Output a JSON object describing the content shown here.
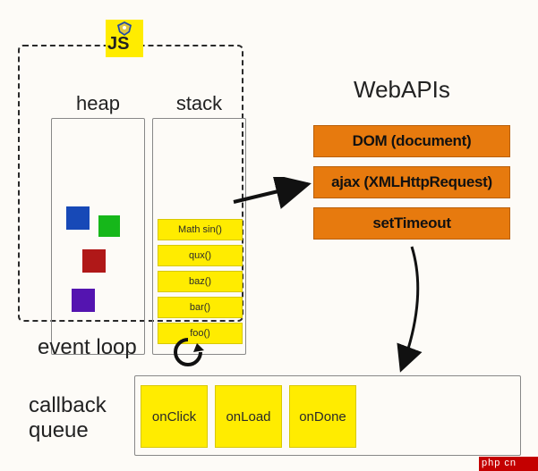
{
  "badge": {
    "label": "JS"
  },
  "heap": {
    "title": "heap"
  },
  "stack": {
    "title": "stack",
    "items": [
      "Math sin()",
      "qux()",
      "baz()",
      "bar()",
      "foo()"
    ]
  },
  "webapis": {
    "title": "WebAPIs",
    "items": [
      "DOM (document)",
      "ajax (XMLHttpRequest)",
      "setTimeout"
    ]
  },
  "event_loop": {
    "label": "event loop"
  },
  "callback_queue": {
    "label": "callback queue",
    "items": [
      "onClick",
      "onLoad",
      "onDone"
    ]
  },
  "watermark": "php cn"
}
